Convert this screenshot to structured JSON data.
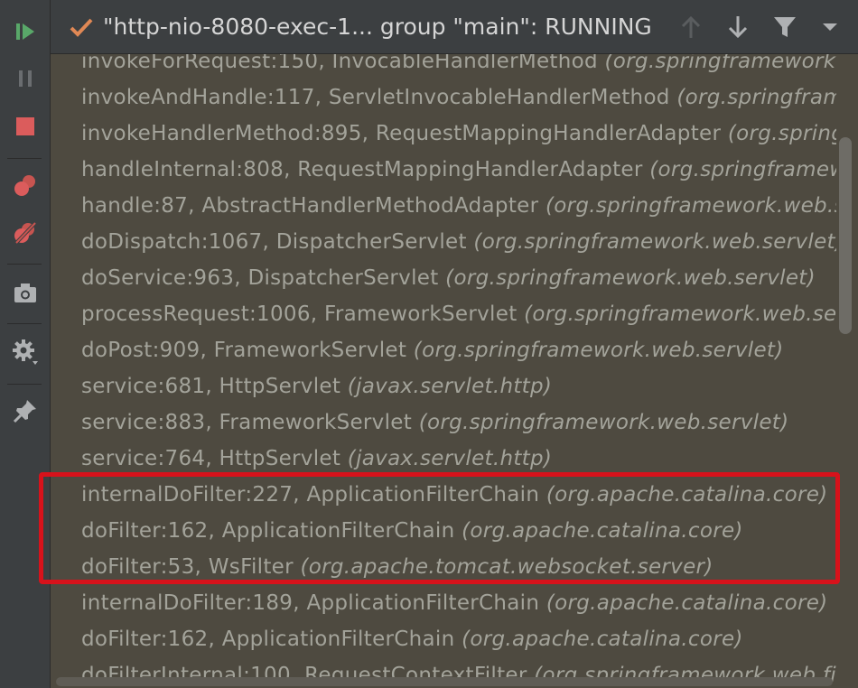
{
  "header": {
    "thread_name": "\"http-nio-8080-exec-1... group \"main\": RUNNING"
  },
  "colors": {
    "toolbar_bg": "#3c3f41",
    "frames_bg": "#4e4a40",
    "frame_text": "#a3a39a",
    "highlight": "#d7121b",
    "resume": "#59a869",
    "stop": "#db5c5c",
    "check": "#e08855"
  },
  "frames": [
    {
      "method": "invokeForRequest:150, InvocableHandlerMethod",
      "pkg": "(org.springframework.web.method.support)"
    },
    {
      "method": "invokeAndHandle:117, ServletInvocableHandlerMethod",
      "pkg": "(org.springframework.web.servlet.mvc.method.annotation)"
    },
    {
      "method": "invokeHandlerMethod:895, RequestMappingHandlerAdapter",
      "pkg": "(org.springframework.web.servlet.mvc.method.annotation)"
    },
    {
      "method": "handleInternal:808, RequestMappingHandlerAdapter",
      "pkg": "(org.springframework.web.servlet.mvc.method.annotation)"
    },
    {
      "method": "handle:87, AbstractHandlerMethodAdapter",
      "pkg": "(org.springframework.web.servlet.mvc.method)"
    },
    {
      "method": "doDispatch:1067, DispatcherServlet",
      "pkg": "(org.springframework.web.servlet)"
    },
    {
      "method": "doService:963, DispatcherServlet",
      "pkg": "(org.springframework.web.servlet)"
    },
    {
      "method": "processRequest:1006, FrameworkServlet",
      "pkg": "(org.springframework.web.servlet)"
    },
    {
      "method": "doPost:909, FrameworkServlet",
      "pkg": "(org.springframework.web.servlet)"
    },
    {
      "method": "service:681, HttpServlet",
      "pkg": "(javax.servlet.http)"
    },
    {
      "method": "service:883, FrameworkServlet",
      "pkg": "(org.springframework.web.servlet)"
    },
    {
      "method": "service:764, HttpServlet",
      "pkg": "(javax.servlet.http)"
    },
    {
      "method": "internalDoFilter:227, ApplicationFilterChain",
      "pkg": "(org.apache.catalina.core)"
    },
    {
      "method": "doFilter:162, ApplicationFilterChain",
      "pkg": "(org.apache.catalina.core)"
    },
    {
      "method": "doFilter:53, WsFilter",
      "pkg": "(org.apache.tomcat.websocket.server)"
    },
    {
      "method": "internalDoFilter:189, ApplicationFilterChain",
      "pkg": "(org.apache.catalina.core)"
    },
    {
      "method": "doFilter:162, ApplicationFilterChain",
      "pkg": "(org.apache.catalina.core)"
    },
    {
      "method": "doFilterInternal:100, RequestContextFilter",
      "pkg": "(org.springframework.web.filter)"
    }
  ]
}
